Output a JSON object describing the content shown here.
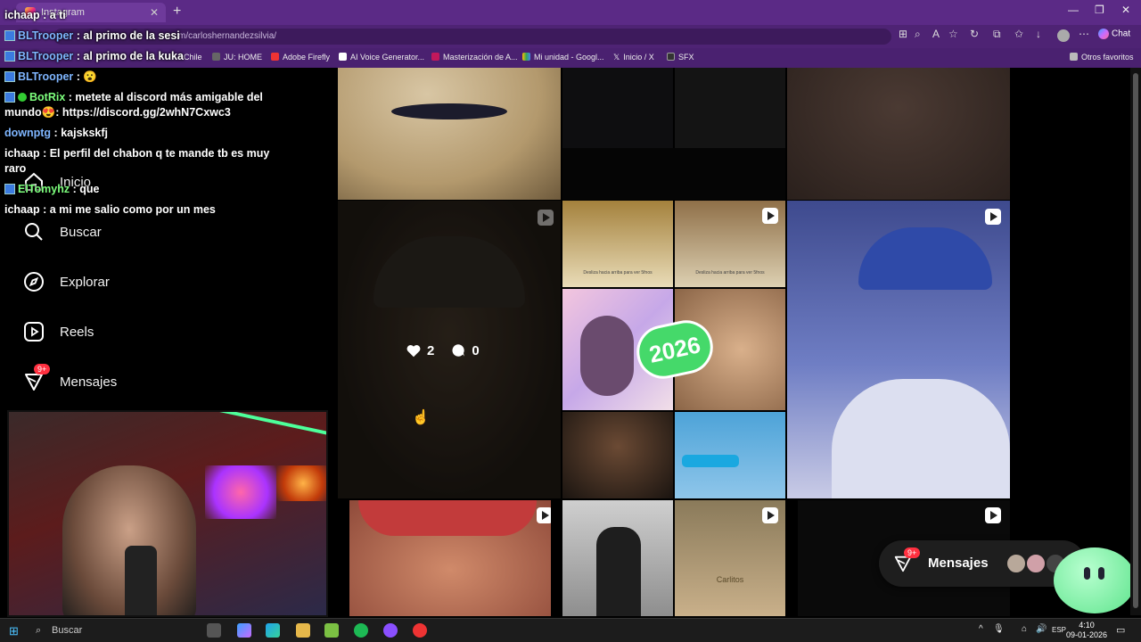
{
  "browser": {
    "tab_title": "Instagram",
    "url": "m/carloshernandezsilvia/",
    "chat_label": "Chat",
    "bookmarks": [
      {
        "label": "Chile"
      },
      {
        "label": "JU: HOME"
      },
      {
        "label": "Adobe Firefly"
      },
      {
        "label": "AI Voice Generator..."
      },
      {
        "label": "Masterización de A..."
      },
      {
        "label": "Mi unidad - Googl..."
      },
      {
        "label": "Inicio / X"
      },
      {
        "label": "SFX"
      }
    ],
    "other_favorites": "Otros favoritos"
  },
  "sidebar": {
    "items": [
      {
        "label": "Inicio",
        "icon": "home-icon"
      },
      {
        "label": "Buscar",
        "icon": "search-icon"
      },
      {
        "label": "Explorar",
        "icon": "compass-icon"
      },
      {
        "label": "Reels",
        "icon": "reels-icon"
      },
      {
        "label": "Mensajes",
        "icon": "messenger-icon",
        "badge": "9+"
      }
    ]
  },
  "post_overlay": {
    "likes": "2",
    "comments": "0"
  },
  "chat": [
    {
      "user": "ichaap",
      "text": "a ti"
    },
    {
      "user": "BLTrooper",
      "text": "al primo de la sesi"
    },
    {
      "user": "BLTrooper",
      "text": "al primo de la kuka"
    },
    {
      "user": "BLTrooper",
      "text": "😮"
    },
    {
      "user": "BotRix",
      "text": "metete al discord más amigable del mundo😍: https://discord.gg/2whN7Cxwc3"
    },
    {
      "user": "downptg",
      "text": "kajskskfj"
    },
    {
      "user": "ichaap",
      "text": "El perfil del chabon q te mande tb es muy raro"
    },
    {
      "user": "ElTomyhz",
      "text": "que"
    },
    {
      "user": "ichaap",
      "text": "a mi me salio como por un mes"
    }
  ],
  "thumbnails": {
    "t1_caption": "Desliza hacia arriba para ver 5fnos",
    "t2_caption": "Desliza hacia arriba para ver 5fnos",
    "year_sticker": "2026",
    "shirt_text": "Carlitos"
  },
  "messages_pill": {
    "label": "Mensajes",
    "badge": "9+"
  },
  "taskbar": {
    "search_placeholder": "Buscar",
    "lang": "ESP",
    "time": "4:10",
    "date": "09-01-2026"
  },
  "colors": {
    "chrome": "#5b2a86",
    "badge": "#ff3040",
    "chat_user_blue": "#7fb6ff",
    "chat_user_green": "#7dff7d"
  }
}
